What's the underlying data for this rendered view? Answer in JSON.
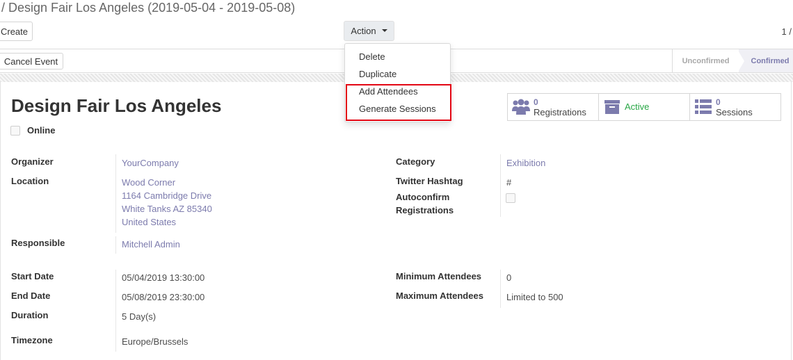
{
  "breadcrumb": "/ Design Fair Los Angeles (2019-05-04 - 2019-05-08)",
  "toolbar": {
    "create_label": "Create",
    "action_label": "Action",
    "pager": "1 /"
  },
  "action_menu": {
    "items": [
      "Delete",
      "Duplicate",
      "Add Attendees",
      "Generate Sessions"
    ]
  },
  "statusbar": {
    "cancel_label": "Cancel Event",
    "stages": [
      "Unconfirmed",
      "Confirmed"
    ],
    "current_stage": "Confirmed"
  },
  "event": {
    "title": "Design Fair Los Angeles",
    "online_label": "Online"
  },
  "smart_buttons": {
    "registrations": {
      "count": "0",
      "label": "Registrations",
      "icon": "users-icon"
    },
    "active": {
      "label": "Active",
      "icon": "archive-box-icon"
    },
    "sessions": {
      "count": "0",
      "label": "Sessions",
      "icon": "list-icon"
    }
  },
  "fields": {
    "organizer": {
      "label": "Organizer",
      "value": "YourCompany"
    },
    "location": {
      "label": "Location",
      "lines": [
        "Wood Corner",
        "1164 Cambridge Drive",
        "White Tanks AZ 85340",
        "United States"
      ]
    },
    "responsible": {
      "label": "Responsible",
      "value": "Mitchell Admin"
    },
    "category": {
      "label": "Category",
      "value": "Exhibition"
    },
    "twitter": {
      "label": "Twitter Hashtag",
      "value": "#"
    },
    "autoconfirm": {
      "label_line1": "Autoconfirm",
      "label_line2": "Registrations"
    },
    "start_date": {
      "label": "Start Date",
      "value": "05/04/2019 13:30:00"
    },
    "end_date": {
      "label": "End Date",
      "value": "05/08/2019 23:30:00"
    },
    "duration": {
      "label": "Duration",
      "value": "5 Day(s)"
    },
    "timezone": {
      "label": "Timezone",
      "value": "Europe/Brussels"
    },
    "min_attendees": {
      "label": "Minimum Attendees",
      "value": "0"
    },
    "max_attendees": {
      "label": "Maximum Attendees",
      "value": "Limited to 500"
    }
  },
  "colors": {
    "link": "#7c7bad",
    "active_green": "#28a745",
    "highlight_red": "#e30613"
  }
}
